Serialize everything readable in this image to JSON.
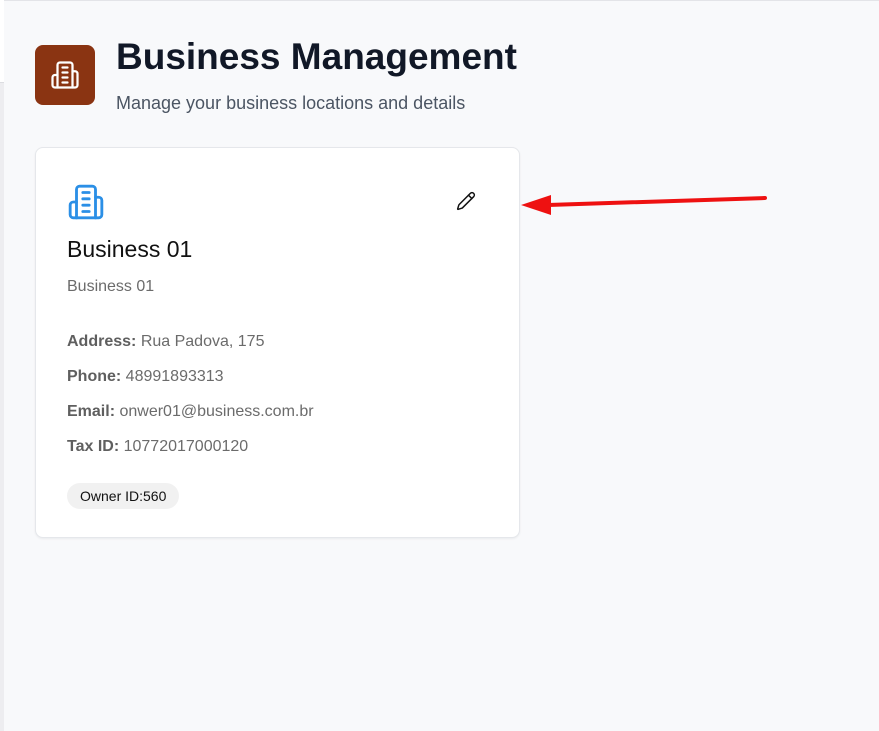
{
  "header": {
    "title": "Business Management",
    "subtitle": "Manage your business locations and details",
    "icon": "building-icon",
    "icon_bg_color": "#8a3412"
  },
  "business_card": {
    "icon": "building-icon",
    "icon_color": "#2b8fe6",
    "edit_icon": "pencil-icon",
    "name": "Business 01",
    "subtitle": "Business 01",
    "details": {
      "address_label": "Address:",
      "address_value": "Rua Padova, 175",
      "phone_label": "Phone:",
      "phone_value": "48991893313",
      "email_label": "Email:",
      "email_value": "onwer01@business.com.br",
      "tax_label": "Tax ID:",
      "tax_value": "10772017000120"
    },
    "owner_badge": "Owner ID:560"
  },
  "annotation": {
    "type": "arrow",
    "color": "#ee1111",
    "points_to": "edit-button"
  }
}
